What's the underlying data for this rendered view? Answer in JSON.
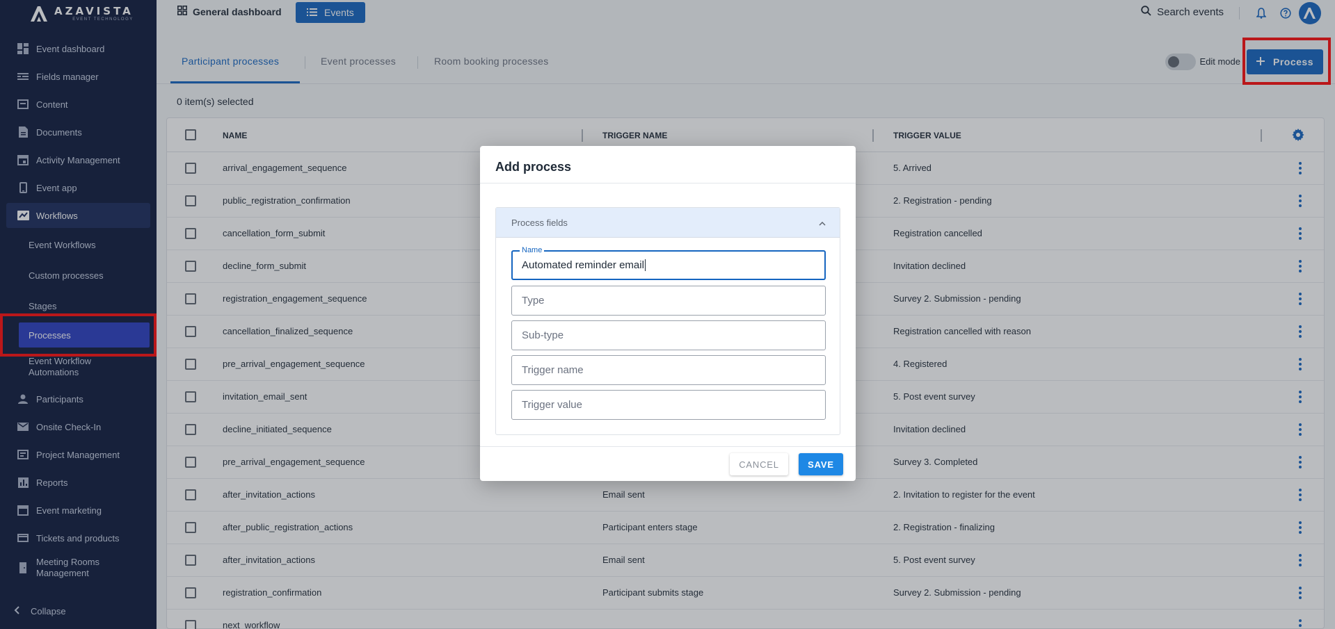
{
  "brand": {
    "name": "AZAVISTA",
    "tagline": "EVENT TECHNOLOGY"
  },
  "sidebar": {
    "items": [
      {
        "label": "Event dashboard",
        "icon": "dashboard-icon"
      },
      {
        "label": "Fields manager",
        "icon": "fields-icon"
      },
      {
        "label": "Content",
        "icon": "content-icon"
      },
      {
        "label": "Documents",
        "icon": "document-icon"
      },
      {
        "label": "Activity Management",
        "icon": "calendar-icon"
      },
      {
        "label": "Event app",
        "icon": "phone-icon"
      },
      {
        "label": "Workflows",
        "icon": "workflow-icon",
        "active": true
      }
    ],
    "sub_items": [
      {
        "label": "Event Workflows"
      },
      {
        "label": "Custom processes"
      },
      {
        "label": "Stages"
      },
      {
        "label": "Processes",
        "active": true
      },
      {
        "label": "Event Workflow Automations"
      }
    ],
    "items_after": [
      {
        "label": "Participants",
        "icon": "person-icon"
      },
      {
        "label": "Onsite Check-In",
        "icon": "mail-icon"
      },
      {
        "label": "Project Management",
        "icon": "project-icon"
      },
      {
        "label": "Reports",
        "icon": "chart-icon"
      },
      {
        "label": "Event marketing",
        "icon": "calendar-icon"
      },
      {
        "label": "Tickets and products",
        "icon": "card-icon"
      },
      {
        "label": "Meeting Rooms Management",
        "icon": "door-icon"
      }
    ],
    "collapse_label": "Collapse"
  },
  "topbar": {
    "dashboard_label": "General dashboard",
    "events_label": "Events",
    "search_label": "Search events"
  },
  "tabs": [
    {
      "label": "Participant processes",
      "active": true
    },
    {
      "label": "Event processes"
    },
    {
      "label": "Room booking processes"
    }
  ],
  "edit_mode_label": "Edit mode",
  "add_process_label": "Process",
  "selected_count": "0 item(s) selected",
  "table": {
    "headers": {
      "name": "NAME",
      "trigger_name": "TRIGGER NAME",
      "trigger_value": "TRIGGER VALUE"
    },
    "rows": [
      {
        "name": "arrival_engagement_sequence",
        "trigger_name": "",
        "trigger_value": "5. Arrived"
      },
      {
        "name": "public_registration_confirmation",
        "trigger_name": "",
        "trigger_value": "2. Registration - pending"
      },
      {
        "name": "cancellation_form_submit",
        "trigger_name": "",
        "trigger_value": "Registration cancelled"
      },
      {
        "name": "decline_form_submit",
        "trigger_name": "",
        "trigger_value": "Invitation declined"
      },
      {
        "name": "registration_engagement_sequence",
        "trigger_name": "",
        "trigger_value": "Survey 2. Submission - pending"
      },
      {
        "name": "cancellation_finalized_sequence",
        "trigger_name": "",
        "trigger_value": "Registration cancelled with reason"
      },
      {
        "name": "pre_arrival_engagement_sequence",
        "trigger_name": "",
        "trigger_value": "4. Registered"
      },
      {
        "name": "invitation_email_sent",
        "trigger_name": "",
        "trigger_value": "5. Post event survey"
      },
      {
        "name": "decline_initiated_sequence",
        "trigger_name": "",
        "trigger_value": "Invitation declined"
      },
      {
        "name": "pre_arrival_engagement_sequence",
        "trigger_name": "",
        "trigger_value": "Survey 3. Completed"
      },
      {
        "name": "after_invitation_actions",
        "trigger_name": "Email sent",
        "trigger_value": "2. Invitation to register for the event"
      },
      {
        "name": "after_public_registration_actions",
        "trigger_name": "Participant enters stage",
        "trigger_value": "2. Registration - finalizing"
      },
      {
        "name": "after_invitation_actions",
        "trigger_name": "Email sent",
        "trigger_value": "5. Post event survey"
      },
      {
        "name": "registration_confirmation",
        "trigger_name": "Participant submits stage",
        "trigger_value": "Survey 2. Submission - pending"
      },
      {
        "name": "next_workflow",
        "trigger_name": "",
        "trigger_value": ""
      }
    ]
  },
  "modal": {
    "title": "Add process",
    "panel_title": "Process fields",
    "name_label": "Name",
    "name_value": "Automated reminder email",
    "type_placeholder": "Type",
    "subtype_placeholder": "Sub-type",
    "trigger_name_placeholder": "Trigger name",
    "trigger_value_placeholder": "Trigger value",
    "cancel_label": "CANCEL",
    "save_label": "SAVE"
  },
  "colors": {
    "sidebar_bg": "#0f1b3d",
    "accent": "#1565c0",
    "active_sub": "#2b3ec1",
    "highlight": "#ff0d0d"
  }
}
